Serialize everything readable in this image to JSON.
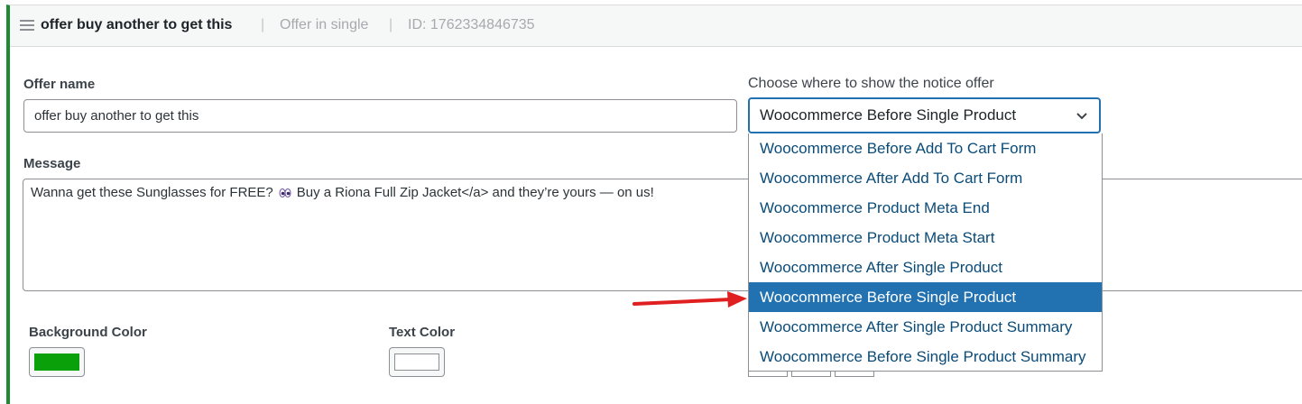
{
  "header": {
    "title": "offer buy another to get this",
    "separator": "|",
    "type": "Offer in single",
    "id_text": "ID: 1762334846735"
  },
  "form": {
    "offer_name_label": "Offer name",
    "offer_name_value": "offer buy another to get this",
    "message_label": "Message",
    "message_before": "Wanna get these Sunglasses for FREE?",
    "message_after": "Buy a Riona Full Zip Jacket</a> and they’re yours — on us!",
    "notice_label": "Choose where to show the notice offer",
    "notice_selected": "Woocommerce Before Single Product",
    "notice_options": [
      "Woocommerce Before Add To Cart Form",
      "Woocommerce After Add To Cart Form",
      "Woocommerce Product Meta End",
      "Woocommerce Product Meta Start",
      "Woocommerce After Single Product",
      "Woocommerce Before Single Product",
      "Woocommerce After Single Product Summary",
      "Woocommerce Before Single Product Summary"
    ],
    "background_color_label": "Background Color",
    "text_color_label": "Text Color"
  },
  "colors": {
    "accent": "#1e8a36",
    "background_color": "#0aa00a",
    "text_color": "#ffffff",
    "select_highlight": "#2271b1",
    "annotation_arrow": "#e02020"
  }
}
